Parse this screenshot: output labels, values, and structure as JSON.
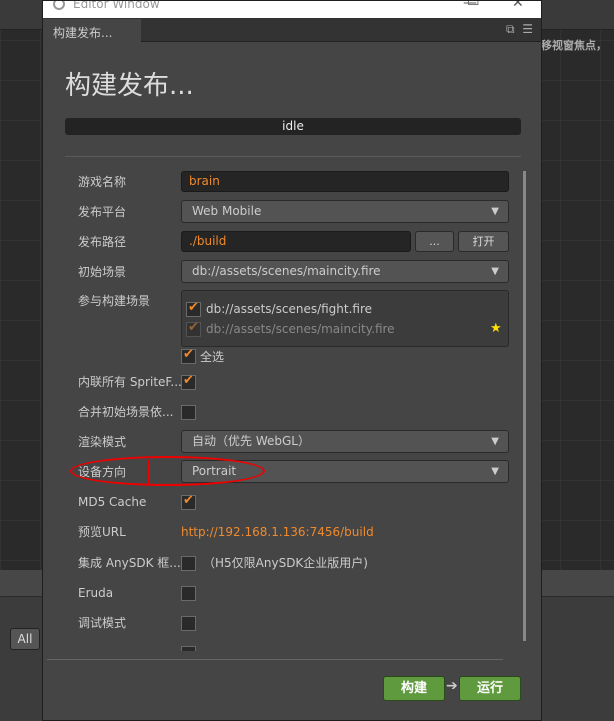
{
  "window": {
    "title": "Editor Window",
    "tab": "构建发布...",
    "heading": "构建发布...",
    "status": "idle"
  },
  "background": {
    "hint": "移视窗焦点，",
    "all_button": "All"
  },
  "fields": {
    "game_name": {
      "label": "游戏名称",
      "value": "brain"
    },
    "platform": {
      "label": "发布平台",
      "value": "Web Mobile"
    },
    "path": {
      "label": "发布路径",
      "value": "./build",
      "browse": "...",
      "open": "打开"
    },
    "start_scene": {
      "label": "初始场景",
      "value": "db://assets/scenes/maincity.fire"
    },
    "scenes": {
      "label": "参与构建场景",
      "items": [
        {
          "value": "db://assets/scenes/fight.fire",
          "checked": true
        },
        {
          "value": "db://assets/scenes/maincity.fire",
          "checked": true,
          "disabled": true,
          "starred": true
        }
      ],
      "select_all": "全选",
      "select_all_checked": true
    },
    "inline_sprite": {
      "label": "内联所有 SpriteF...",
      "checked": true
    },
    "merge_start": {
      "label": "合并初始场景依...",
      "checked": false
    },
    "render_mode": {
      "label": "渲染模式",
      "value": "自动（优先 WebGL）"
    },
    "orientation": {
      "label": "设备方向",
      "value": "Portrait"
    },
    "md5": {
      "label": "MD5 Cache",
      "checked": true
    },
    "preview_url": {
      "label": "预览URL",
      "value": "http://192.168.1.136:7456/build"
    },
    "anysdk": {
      "label": "集成 AnySDK 框...",
      "checked": false,
      "note": "（H5仅限AnySDK企业版用户)"
    },
    "eruda": {
      "label": "Eruda",
      "checked": false
    },
    "debug": {
      "label": "调试模式",
      "checked": false
    }
  },
  "footer": {
    "build": "构建",
    "run": "运行"
  },
  "colors": {
    "accent": "#f08a2c",
    "green_button": "#5f9a3f",
    "annotation": "#e00000"
  }
}
